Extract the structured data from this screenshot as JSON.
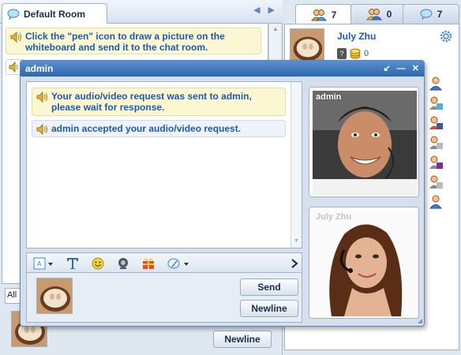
{
  "room": {
    "tab_label": "Default Room",
    "hint_message": "Click the \"pen\" icon to draw a picture on the whiteboard and send it to the chat room.",
    "filter_value": "All",
    "newline_label": "Newline"
  },
  "users": {
    "tabs": [
      {
        "icon": "users-icon",
        "count": "7"
      },
      {
        "icon": "friends-icon",
        "count": "0"
      },
      {
        "icon": "chat-bubble-icon",
        "count": "7"
      }
    ],
    "me": {
      "name": "July Zhu",
      "coins": "0"
    },
    "list_icons": [
      "user-icon",
      "user-messenger-icon",
      "user-facebook-icon",
      "user-google-icon",
      "user-yahoo-icon",
      "user-google-icon",
      "user-icon"
    ]
  },
  "dialog": {
    "title": "admin",
    "messages": [
      "Your audio/video request was sent to admin, please wait for response.",
      "admin accepted your audio/video request."
    ],
    "send_label": "Send",
    "newline_label": "Newline",
    "video_remote_label": "admin",
    "video_local_label": "July Zhu"
  },
  "colors": {
    "accent": "#2e67ad",
    "link_text": "#1e5aa8",
    "hint_bg": "#fbf7d3"
  }
}
